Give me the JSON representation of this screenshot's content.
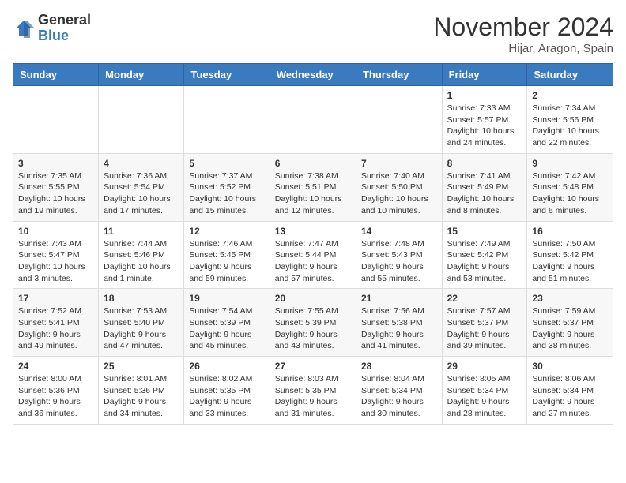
{
  "header": {
    "logo_general": "General",
    "logo_blue": "Blue",
    "month_title": "November 2024",
    "location": "Hijar, Aragon, Spain"
  },
  "days_of_week": [
    "Sunday",
    "Monday",
    "Tuesday",
    "Wednesday",
    "Thursday",
    "Friday",
    "Saturday"
  ],
  "weeks": [
    [
      {
        "day": "",
        "info": ""
      },
      {
        "day": "",
        "info": ""
      },
      {
        "day": "",
        "info": ""
      },
      {
        "day": "",
        "info": ""
      },
      {
        "day": "",
        "info": ""
      },
      {
        "day": "1",
        "info": "Sunrise: 7:33 AM\nSunset: 5:57 PM\nDaylight: 10 hours and 24 minutes."
      },
      {
        "day": "2",
        "info": "Sunrise: 7:34 AM\nSunset: 5:56 PM\nDaylight: 10 hours and 22 minutes."
      }
    ],
    [
      {
        "day": "3",
        "info": "Sunrise: 7:35 AM\nSunset: 5:55 PM\nDaylight: 10 hours and 19 minutes."
      },
      {
        "day": "4",
        "info": "Sunrise: 7:36 AM\nSunset: 5:54 PM\nDaylight: 10 hours and 17 minutes."
      },
      {
        "day": "5",
        "info": "Sunrise: 7:37 AM\nSunset: 5:52 PM\nDaylight: 10 hours and 15 minutes."
      },
      {
        "day": "6",
        "info": "Sunrise: 7:38 AM\nSunset: 5:51 PM\nDaylight: 10 hours and 12 minutes."
      },
      {
        "day": "7",
        "info": "Sunrise: 7:40 AM\nSunset: 5:50 PM\nDaylight: 10 hours and 10 minutes."
      },
      {
        "day": "8",
        "info": "Sunrise: 7:41 AM\nSunset: 5:49 PM\nDaylight: 10 hours and 8 minutes."
      },
      {
        "day": "9",
        "info": "Sunrise: 7:42 AM\nSunset: 5:48 PM\nDaylight: 10 hours and 6 minutes."
      }
    ],
    [
      {
        "day": "10",
        "info": "Sunrise: 7:43 AM\nSunset: 5:47 PM\nDaylight: 10 hours and 3 minutes."
      },
      {
        "day": "11",
        "info": "Sunrise: 7:44 AM\nSunset: 5:46 PM\nDaylight: 10 hours and 1 minute."
      },
      {
        "day": "12",
        "info": "Sunrise: 7:46 AM\nSunset: 5:45 PM\nDaylight: 9 hours and 59 minutes."
      },
      {
        "day": "13",
        "info": "Sunrise: 7:47 AM\nSunset: 5:44 PM\nDaylight: 9 hours and 57 minutes."
      },
      {
        "day": "14",
        "info": "Sunrise: 7:48 AM\nSunset: 5:43 PM\nDaylight: 9 hours and 55 minutes."
      },
      {
        "day": "15",
        "info": "Sunrise: 7:49 AM\nSunset: 5:42 PM\nDaylight: 9 hours and 53 minutes."
      },
      {
        "day": "16",
        "info": "Sunrise: 7:50 AM\nSunset: 5:42 PM\nDaylight: 9 hours and 51 minutes."
      }
    ],
    [
      {
        "day": "17",
        "info": "Sunrise: 7:52 AM\nSunset: 5:41 PM\nDaylight: 9 hours and 49 minutes."
      },
      {
        "day": "18",
        "info": "Sunrise: 7:53 AM\nSunset: 5:40 PM\nDaylight: 9 hours and 47 minutes."
      },
      {
        "day": "19",
        "info": "Sunrise: 7:54 AM\nSunset: 5:39 PM\nDaylight: 9 hours and 45 minutes."
      },
      {
        "day": "20",
        "info": "Sunrise: 7:55 AM\nSunset: 5:39 PM\nDaylight: 9 hours and 43 minutes."
      },
      {
        "day": "21",
        "info": "Sunrise: 7:56 AM\nSunset: 5:38 PM\nDaylight: 9 hours and 41 minutes."
      },
      {
        "day": "22",
        "info": "Sunrise: 7:57 AM\nSunset: 5:37 PM\nDaylight: 9 hours and 39 minutes."
      },
      {
        "day": "23",
        "info": "Sunrise: 7:59 AM\nSunset: 5:37 PM\nDaylight: 9 hours and 38 minutes."
      }
    ],
    [
      {
        "day": "24",
        "info": "Sunrise: 8:00 AM\nSunset: 5:36 PM\nDaylight: 9 hours and 36 minutes."
      },
      {
        "day": "25",
        "info": "Sunrise: 8:01 AM\nSunset: 5:36 PM\nDaylight: 9 hours and 34 minutes."
      },
      {
        "day": "26",
        "info": "Sunrise: 8:02 AM\nSunset: 5:35 PM\nDaylight: 9 hours and 33 minutes."
      },
      {
        "day": "27",
        "info": "Sunrise: 8:03 AM\nSunset: 5:35 PM\nDaylight: 9 hours and 31 minutes."
      },
      {
        "day": "28",
        "info": "Sunrise: 8:04 AM\nSunset: 5:34 PM\nDaylight: 9 hours and 30 minutes."
      },
      {
        "day": "29",
        "info": "Sunrise: 8:05 AM\nSunset: 5:34 PM\nDaylight: 9 hours and 28 minutes."
      },
      {
        "day": "30",
        "info": "Sunrise: 8:06 AM\nSunset: 5:34 PM\nDaylight: 9 hours and 27 minutes."
      }
    ]
  ]
}
